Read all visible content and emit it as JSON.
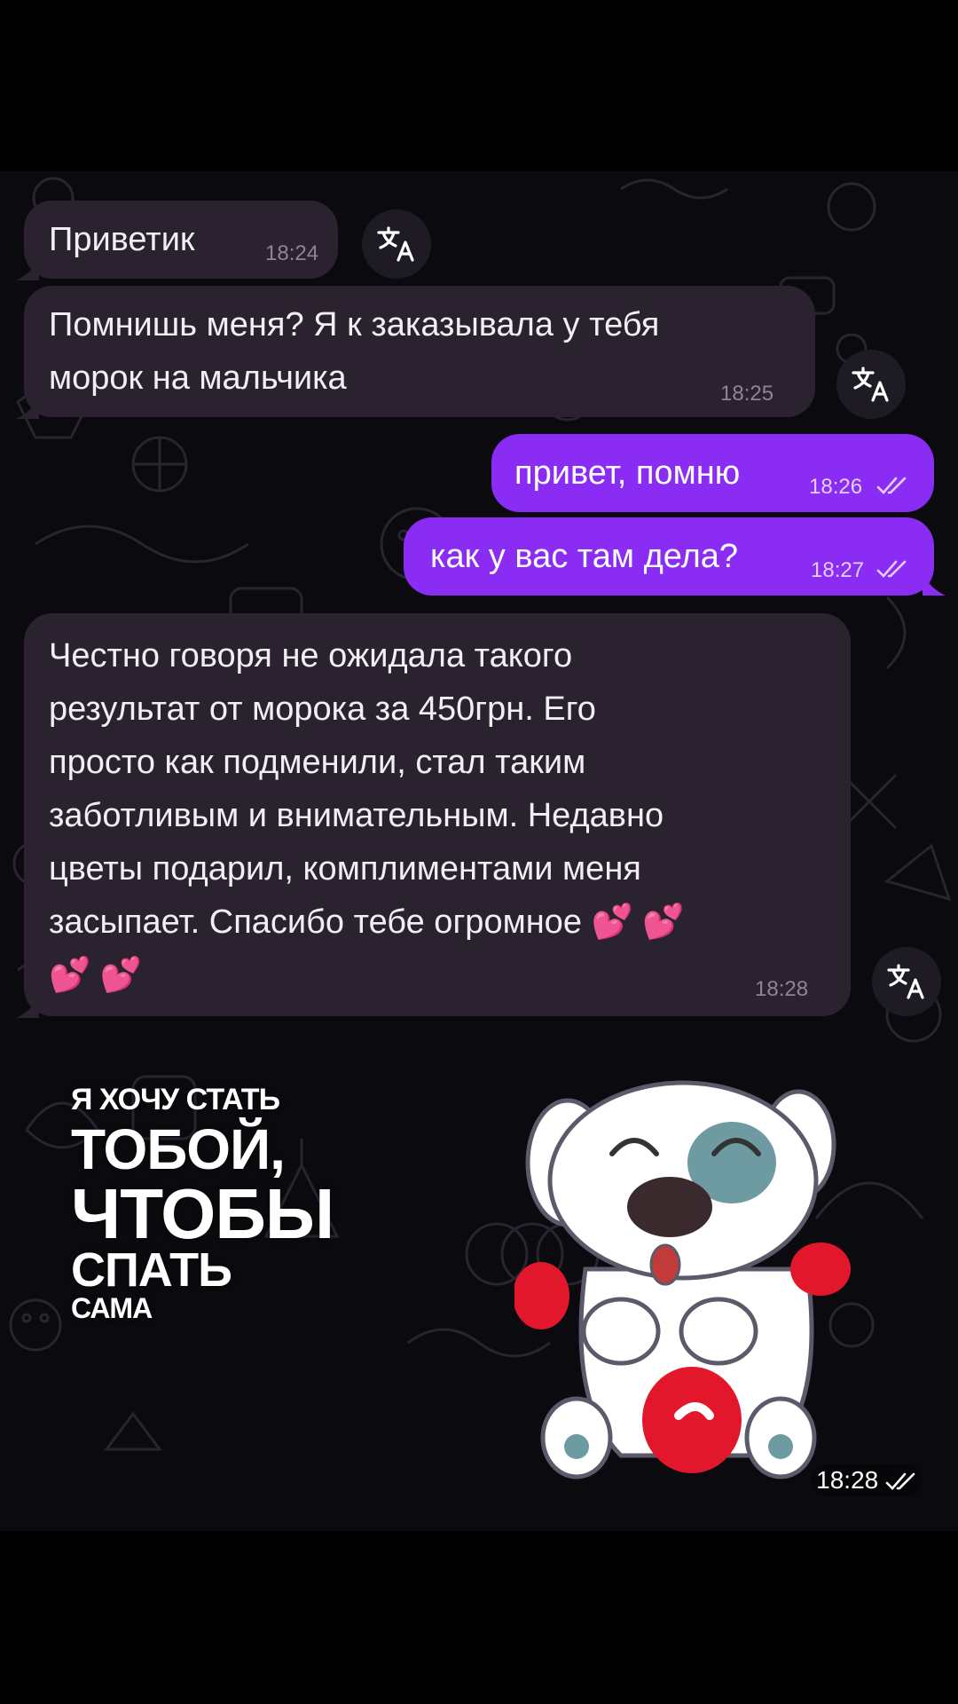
{
  "messages": [
    {
      "direction": "in",
      "text": "Приветик",
      "time": "18:24"
    },
    {
      "direction": "in",
      "text": "Помнишь меня? Я к заказывала у тебя\nморок на мальчика",
      "time": "18:25"
    },
    {
      "direction": "out",
      "text": "привет, помню",
      "time": "18:26"
    },
    {
      "direction": "out",
      "text": "как у вас там дела?",
      "time": "18:27"
    },
    {
      "direction": "in",
      "text": "Честно говоря не ожидала такого\nрезультат от морока за 450грн. Его\nпросто как подменили, стал таким\nзаботливым и внимательным. Недавно\nцветы подарил, комплиментами меня\nзасыпает. Спасибо тебе огромное 💕 💕\n💕 💕",
      "time": "18:28"
    }
  ],
  "sticker": {
    "lines": [
      "Я ХОЧУ СТАТЬ",
      "ТОБОЙ,",
      "ЧТОБЫ",
      "СПАТЬ",
      "САМА"
    ],
    "time": "18:28"
  },
  "icons": {
    "translate": "translate-icon",
    "read_receipt": "double-check-icon"
  },
  "colors": {
    "incoming_bubble": "#2b2230",
    "outgoing_bubble": "#8b2cf5",
    "background": "#0b0a0e"
  }
}
